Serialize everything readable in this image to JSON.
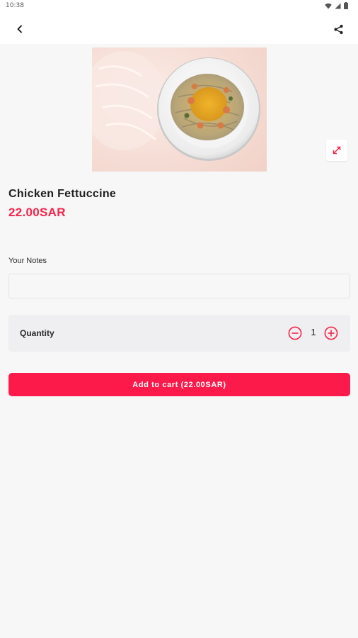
{
  "status_bar": {
    "time": "10:38",
    "icons": [
      "wifi-icon",
      "signal-icon",
      "battery-icon"
    ]
  },
  "header": {
    "back_icon": "chevron-left-icon",
    "share_icon": "share-icon"
  },
  "product": {
    "image_icon": "pasta-dish-image",
    "expand_icon": "expand-icon",
    "name": "Chicken Fettuccine",
    "price": "22.00SAR"
  },
  "notes": {
    "label": "Your Notes",
    "value": "",
    "placeholder": ""
  },
  "quantity": {
    "label": "Quantity",
    "value": "1",
    "minus_icon": "minus-circle-icon",
    "plus_icon": "plus-circle-icon"
  },
  "cart": {
    "button_label": "Add to cart (22.00SAR)"
  },
  "colors": {
    "accent": "#fb1a4a",
    "price": "#f5244a",
    "background": "#f7f7f7"
  }
}
